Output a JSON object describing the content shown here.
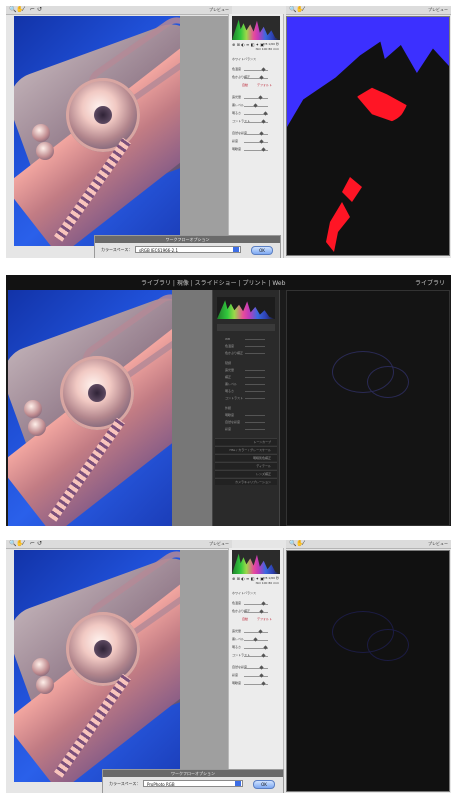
{
  "toolbar": {
    "tool_icons": [
      "zoom-icon",
      "hand-icon",
      "eyedropper-icon",
      "color-sampler-icon",
      "crop-icon",
      "rotate-left-icon",
      "rotate-right-icon"
    ],
    "preview_label": "プレビュー"
  },
  "panels": [
    {
      "id": "p1",
      "readout": [
        "R:",
        "G:",
        "B:"
      ],
      "readout2": [
        "f/8 1/60 秒",
        "ISO 100 80 mm"
      ],
      "dialog": {
        "title": "ワークフローオプション",
        "colorspace_label": "カラースペース：",
        "colorspace_value": "sRGB IEC61966-2.1",
        "ok_label": "OK"
      }
    },
    {
      "id": "p2",
      "modules": "ライブラリ | 現像 | スライドショー | プリント | Web",
      "right_module": "ライブラリ"
    },
    {
      "id": "p3",
      "dialog": {
        "title": "ワークフローオプション",
        "colorspace_label": "カラースペース：",
        "colorspace_value": "ProPhoto RGB",
        "ok_label": "OK"
      }
    }
  ],
  "acr_rows": [
    "ホワイトバランス",
    "色温度",
    "色かぶり補正",
    "自動",
    "デフォルト",
    "露光量",
    "黒レベル",
    "明るさ",
    "コントラスト",
    "自然な彩度",
    "彩度",
    "明瞭度"
  ],
  "lr_sections": [
    "基本補正",
    "トーンカーブ",
    "HSL / カラー / グレースケール",
    "明暗別色補正",
    "ディテール",
    "レンズ補正",
    "カメラキャリブレーション"
  ],
  "lr_rows": [
    "WB",
    "色温度",
    "色かぶり補正",
    "階調",
    "露光量",
    "補正",
    "黒レベル",
    "明るさ",
    "コントラスト",
    "外観",
    "明瞭度",
    "自然な彩度",
    "彩度"
  ]
}
